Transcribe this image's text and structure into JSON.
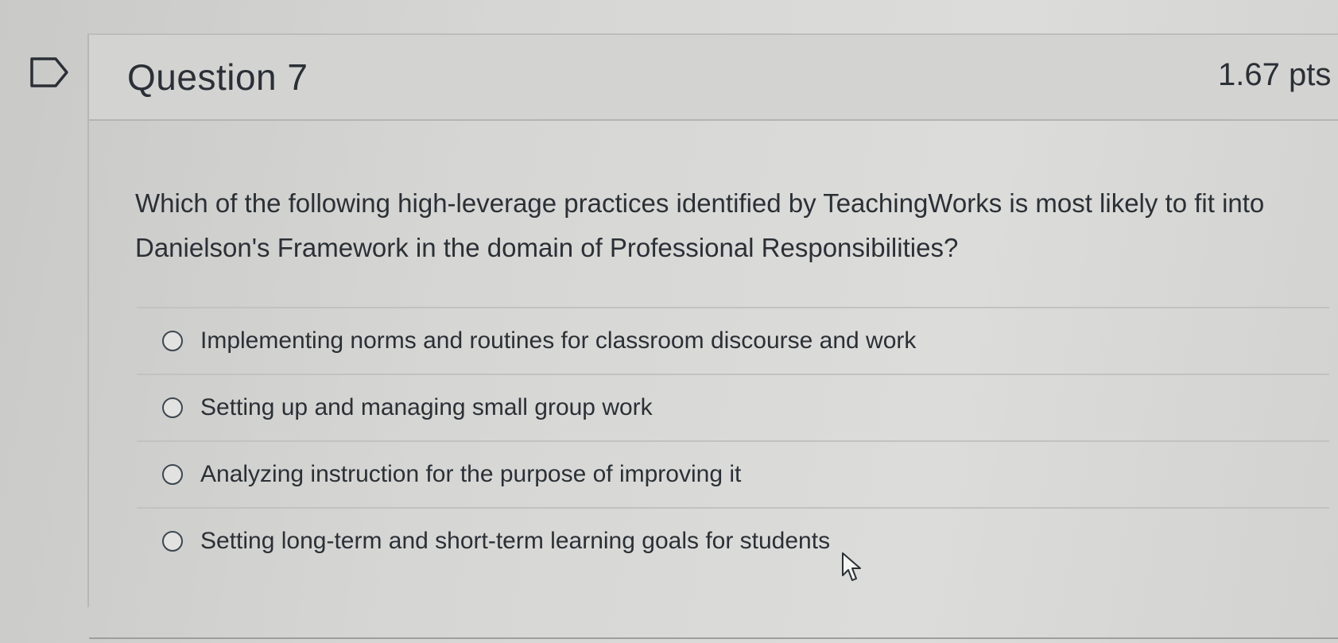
{
  "question": {
    "title": "Question 7",
    "points": "1.67 pts",
    "text": "Which of the following high-leverage practices identified by TeachingWorks is most likely to fit into Danielson's Framework in the domain of Professional Responsibilities?",
    "answers": [
      {
        "label": "Implementing norms and routines for classroom discourse and work",
        "selected": false
      },
      {
        "label": "Setting up and managing small group work",
        "selected": false
      },
      {
        "label": "Analyzing instruction for the purpose of improving it",
        "selected": false
      },
      {
        "label": "Setting long-term and short-term learning goals for students",
        "selected": false
      }
    ]
  },
  "icons": {
    "flag": "flag-question-icon",
    "cursor": "mouse-pointer-icon"
  },
  "colors": {
    "text": "#2b3036",
    "background": "#d6d6d4"
  }
}
